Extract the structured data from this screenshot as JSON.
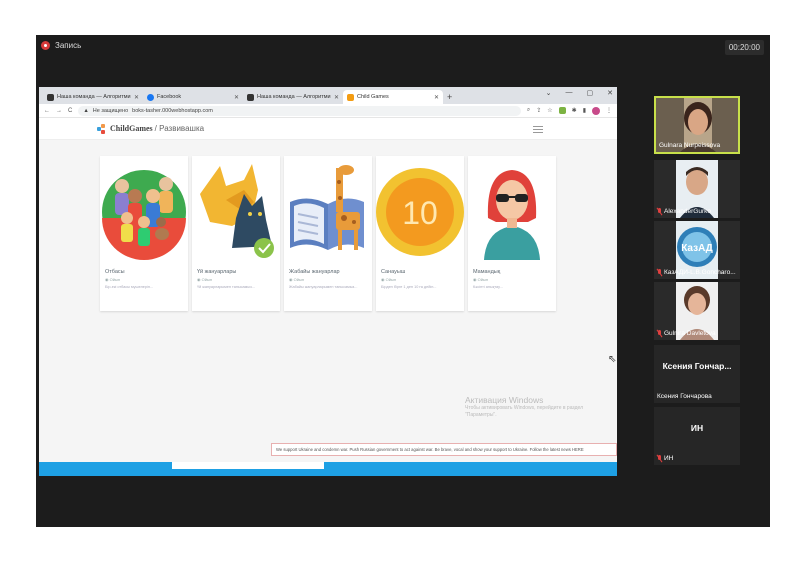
{
  "meeting": {
    "record_label": "Запись",
    "timer": "00:20:00",
    "participants": [
      {
        "name": "Gulnara Nurpeissova",
        "muted": false,
        "has_video": true,
        "active": true
      },
      {
        "name": "AlexanderGurko",
        "muted": true,
        "has_video": true
      },
      {
        "name": "КазАДИ-L.B.Goncharo...",
        "muted": true,
        "has_video": true
      },
      {
        "name": "Gulnira Davletova",
        "muted": true,
        "has_video": true
      },
      {
        "name": "Ксения Гончарова",
        "big_label": "Ксения Гончар...",
        "muted": false,
        "has_video": false
      },
      {
        "name": "ИН",
        "big_label": "ИН",
        "muted": true,
        "has_video": false
      }
    ]
  },
  "browser": {
    "tabs": [
      {
        "label": "Наша команда — Алгоритмика",
        "icon": "algoritmika-icon",
        "color": "#333333"
      },
      {
        "label": "Facebook",
        "icon": "facebook-icon",
        "color": "#1877f2"
      },
      {
        "label": "Наша команда — Алгоритмика",
        "icon": "algoritmika-icon",
        "color": "#333333"
      },
      {
        "label": "Child Games",
        "icon": "childgames-icon",
        "color": "#f39c12",
        "active": true
      }
    ],
    "security_label": "Не защищено",
    "url": "boks-tasher.000webhostapp.com"
  },
  "site": {
    "brand": "ChildGames",
    "brand_sub": "/ Развивашка",
    "cards": [
      {
        "title": "Отбасы",
        "meta": "Ойын",
        "desc": "Бір-екі отбасы мүшелерін...",
        "image": "family"
      },
      {
        "title": "Үй жануарлары",
        "meta": "Ойын",
        "desc": "Үй жануарларымен танысамыз...",
        "image": "pets"
      },
      {
        "title": "Жабайы жануарлар",
        "meta": "Ойын",
        "desc": "Жабайы жануарларымен танысамыз...",
        "image": "wild"
      },
      {
        "title": "Санауыш",
        "meta": "Ойын",
        "desc": "Бірден бірге 1 ден 10 ға дейін...",
        "image": "counting"
      },
      {
        "title": "Мамандық",
        "meta": "Ойын",
        "desc": "Кәсіпті анықтау...",
        "image": "profession"
      }
    ],
    "windows_activation": {
      "title": "Активация Windows",
      "text": "Чтобы активировать Windows, перейдите в раздел \"Параметры\"."
    },
    "banner": "We support Ukraine and condemn war. Push Russian government to act against war. Be brave, vocal and show your support to Ukraine. Follow the latest news HERE"
  }
}
